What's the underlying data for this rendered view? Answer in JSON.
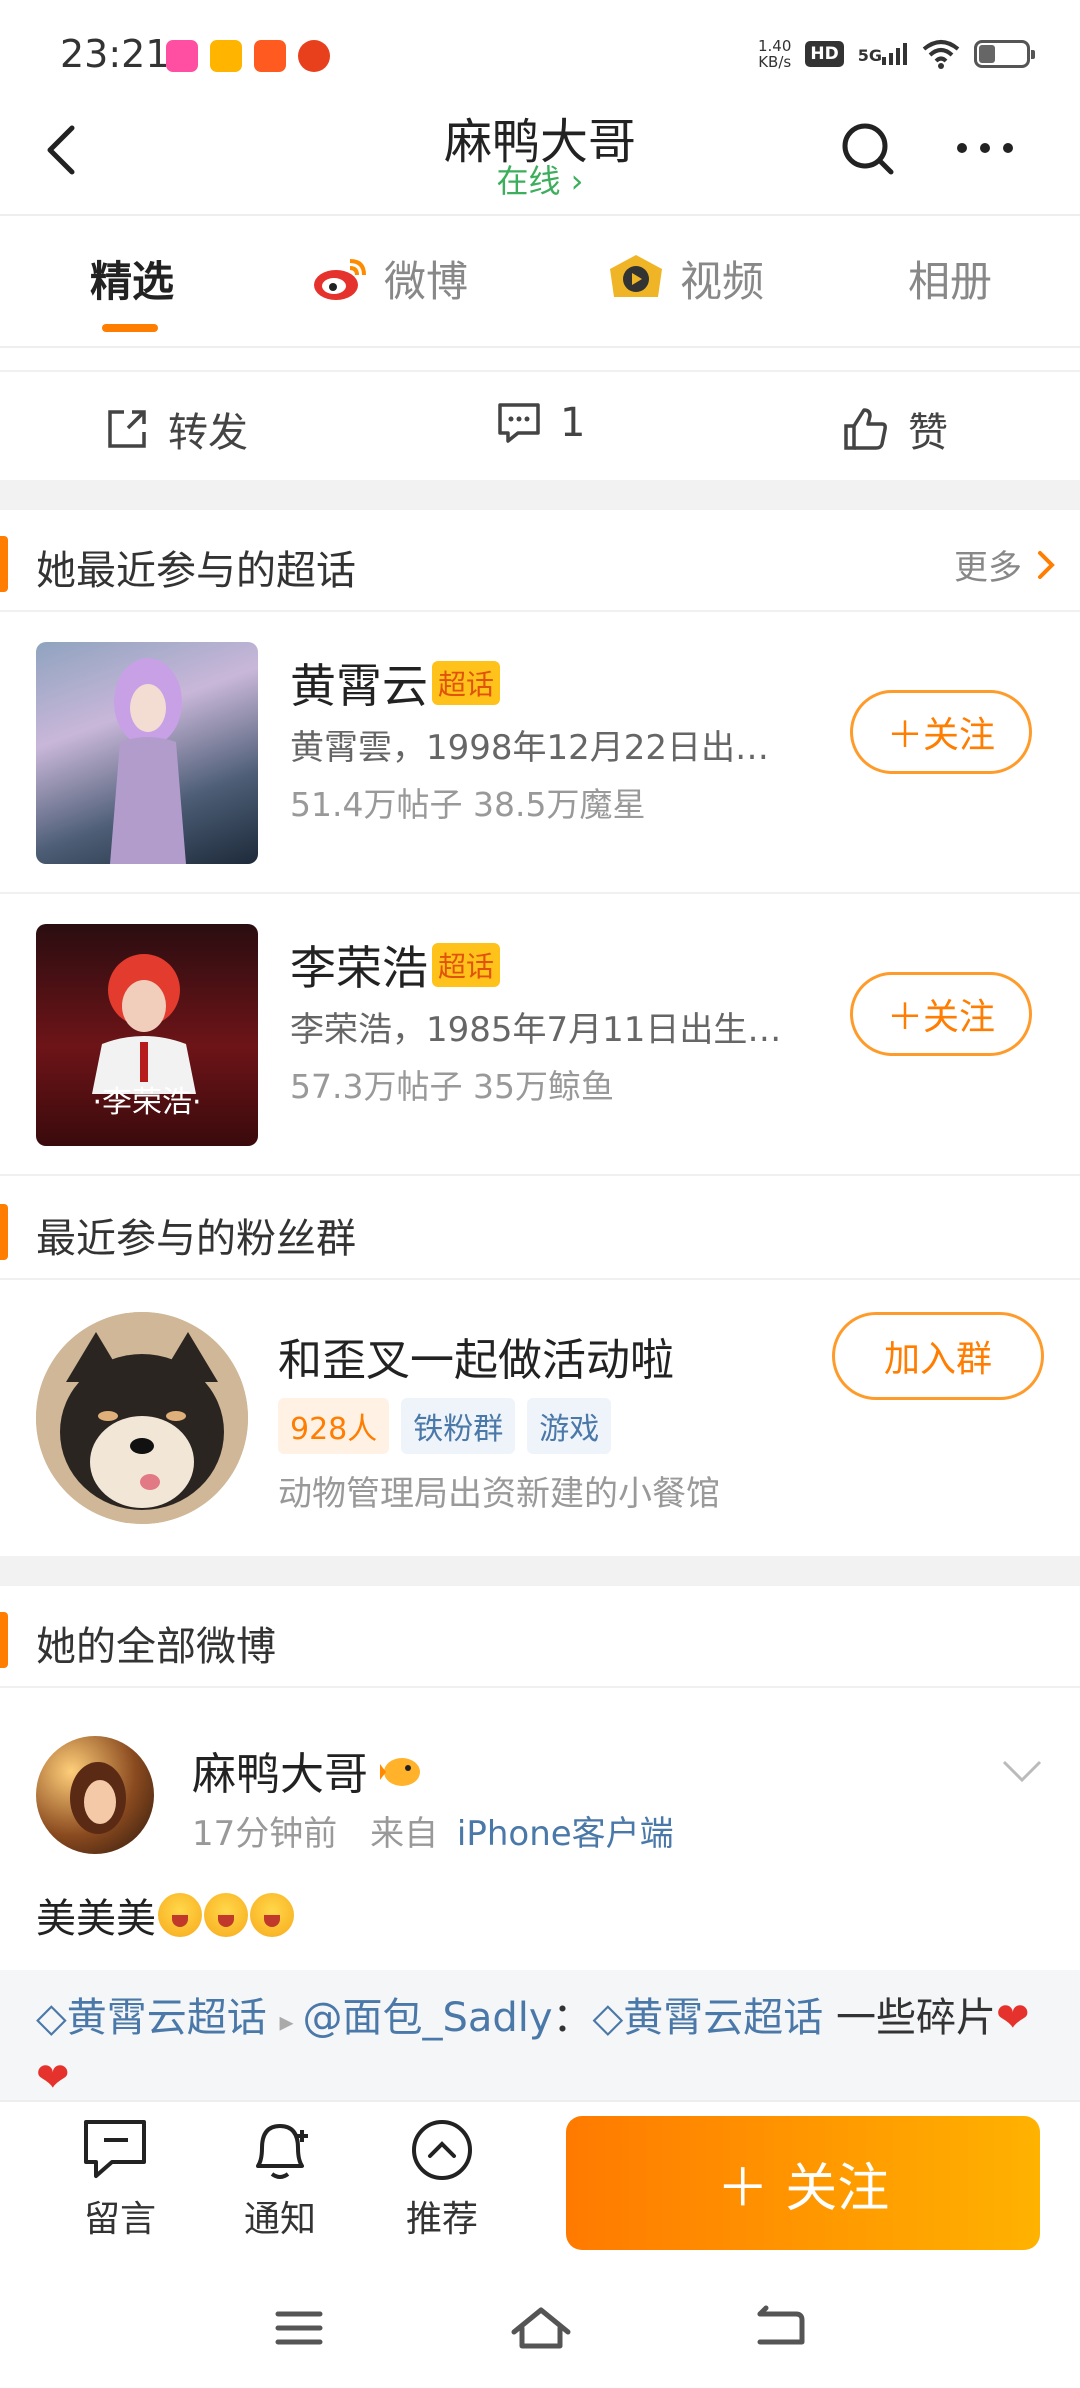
{
  "status_bar": {
    "time": "23:21",
    "net_speed_value": "1.40",
    "net_speed_unit": "KB/s",
    "hd_badge": "HD",
    "network": "5G",
    "battery_level": 0.35
  },
  "header": {
    "title": "麻鸭大哥",
    "status": "在线 ›"
  },
  "tabs": [
    {
      "label": "精选",
      "active": true
    },
    {
      "label": "微博",
      "active": false
    },
    {
      "label": "视频",
      "active": false
    },
    {
      "label": "相册",
      "active": false
    }
  ],
  "actions": {
    "repost": "转发",
    "comment_count": "1",
    "like": "赞"
  },
  "supertopics": {
    "title": "她最近参与的超话",
    "more": "更多",
    "items": [
      {
        "name": "黄霄云",
        "badge": "超话",
        "desc": "黄霄雲，1998年12月22日出…",
        "stats": "51.4万帖子 38.5万魔星",
        "follow": "＋关注"
      },
      {
        "name": "李荣浩",
        "badge": "超话",
        "desc": "李荣浩，1985年7月11日出生…",
        "stats": "57.3万帖子 35万鲸鱼",
        "follow": "＋关注",
        "thumb_caption": "·李荣浩·"
      }
    ]
  },
  "fan_groups": {
    "title": "最近参与的粉丝群",
    "group": {
      "name": "和歪叉一起做活动啦",
      "tags": [
        "928人",
        "铁粉群",
        "游戏"
      ],
      "desc": "动物管理局出资新建的小餐馆",
      "join": "加入群"
    }
  },
  "all_posts": {
    "title": "她的全部微博",
    "post": {
      "author": "麻鸭大哥",
      "time": "17分钟前",
      "source_prefix": "来自",
      "source": "iPhone客户端",
      "text": "美美美",
      "repost_topic1": "黄霄云超话",
      "repost_user": "@面包_Sadly",
      "repost_sep": "：",
      "repost_topic2": "黄霄云超话",
      "repost_text": " 一些碎片",
      "hearts": "❤❤"
    }
  },
  "bottom_bar": {
    "message": "留言",
    "notify": "通知",
    "recommend": "推荐",
    "follow": "＋ 关注"
  },
  "colors": {
    "accent": "#ff7d00",
    "online": "#3cae5c",
    "link": "#4a78a8"
  }
}
